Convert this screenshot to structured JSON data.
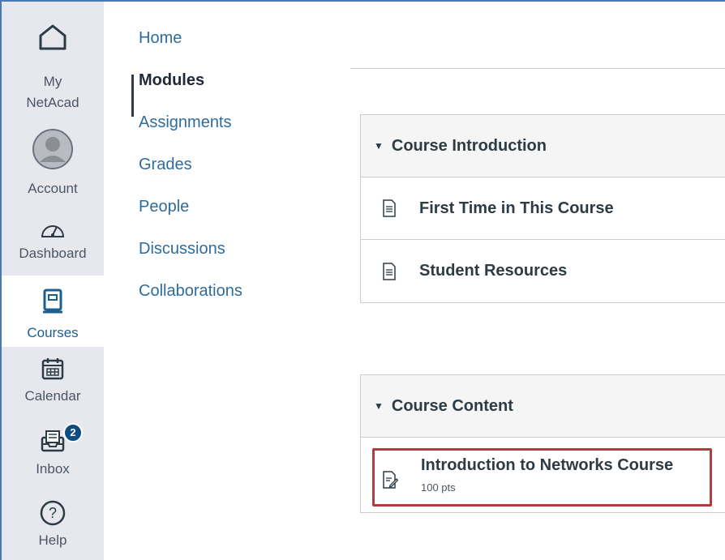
{
  "global_nav": {
    "items": [
      {
        "label": "My\nNetAcad",
        "icon": "home-icon"
      },
      {
        "label": "Account",
        "icon": "avatar-icon"
      },
      {
        "label": "Dashboard",
        "icon": "dashboard-gauge-icon"
      },
      {
        "label": "Courses",
        "icon": "book-icon",
        "active": true
      },
      {
        "label": "Calendar",
        "icon": "calendar-icon"
      },
      {
        "label": "Inbox",
        "icon": "inbox-icon",
        "badge": "2"
      },
      {
        "label": "Help",
        "icon": "help-question-icon"
      }
    ]
  },
  "course_nav": {
    "items": [
      {
        "label": "Home"
      },
      {
        "label": "Modules",
        "active": true
      },
      {
        "label": "Assignments"
      },
      {
        "label": "Grades"
      },
      {
        "label": "People"
      },
      {
        "label": "Discussions"
      },
      {
        "label": "Collaborations"
      }
    ]
  },
  "modules": [
    {
      "title": "Course Introduction",
      "items": [
        {
          "title": "First Time in This Course",
          "icon": "page-document-icon"
        },
        {
          "title": "Student Resources",
          "icon": "page-document-icon"
        }
      ]
    },
    {
      "title": "Course Content",
      "items": [
        {
          "title": "Introduction to Networks Course",
          "points": "100 pts",
          "icon": "assignment-icon"
        }
      ]
    }
  ],
  "colors": {
    "nav_bg": "#e6e8ee",
    "link": "#2d6c9c",
    "active_text": "#1c5f8f",
    "badge": "#0f4c81",
    "highlight": "#b53a3a"
  }
}
